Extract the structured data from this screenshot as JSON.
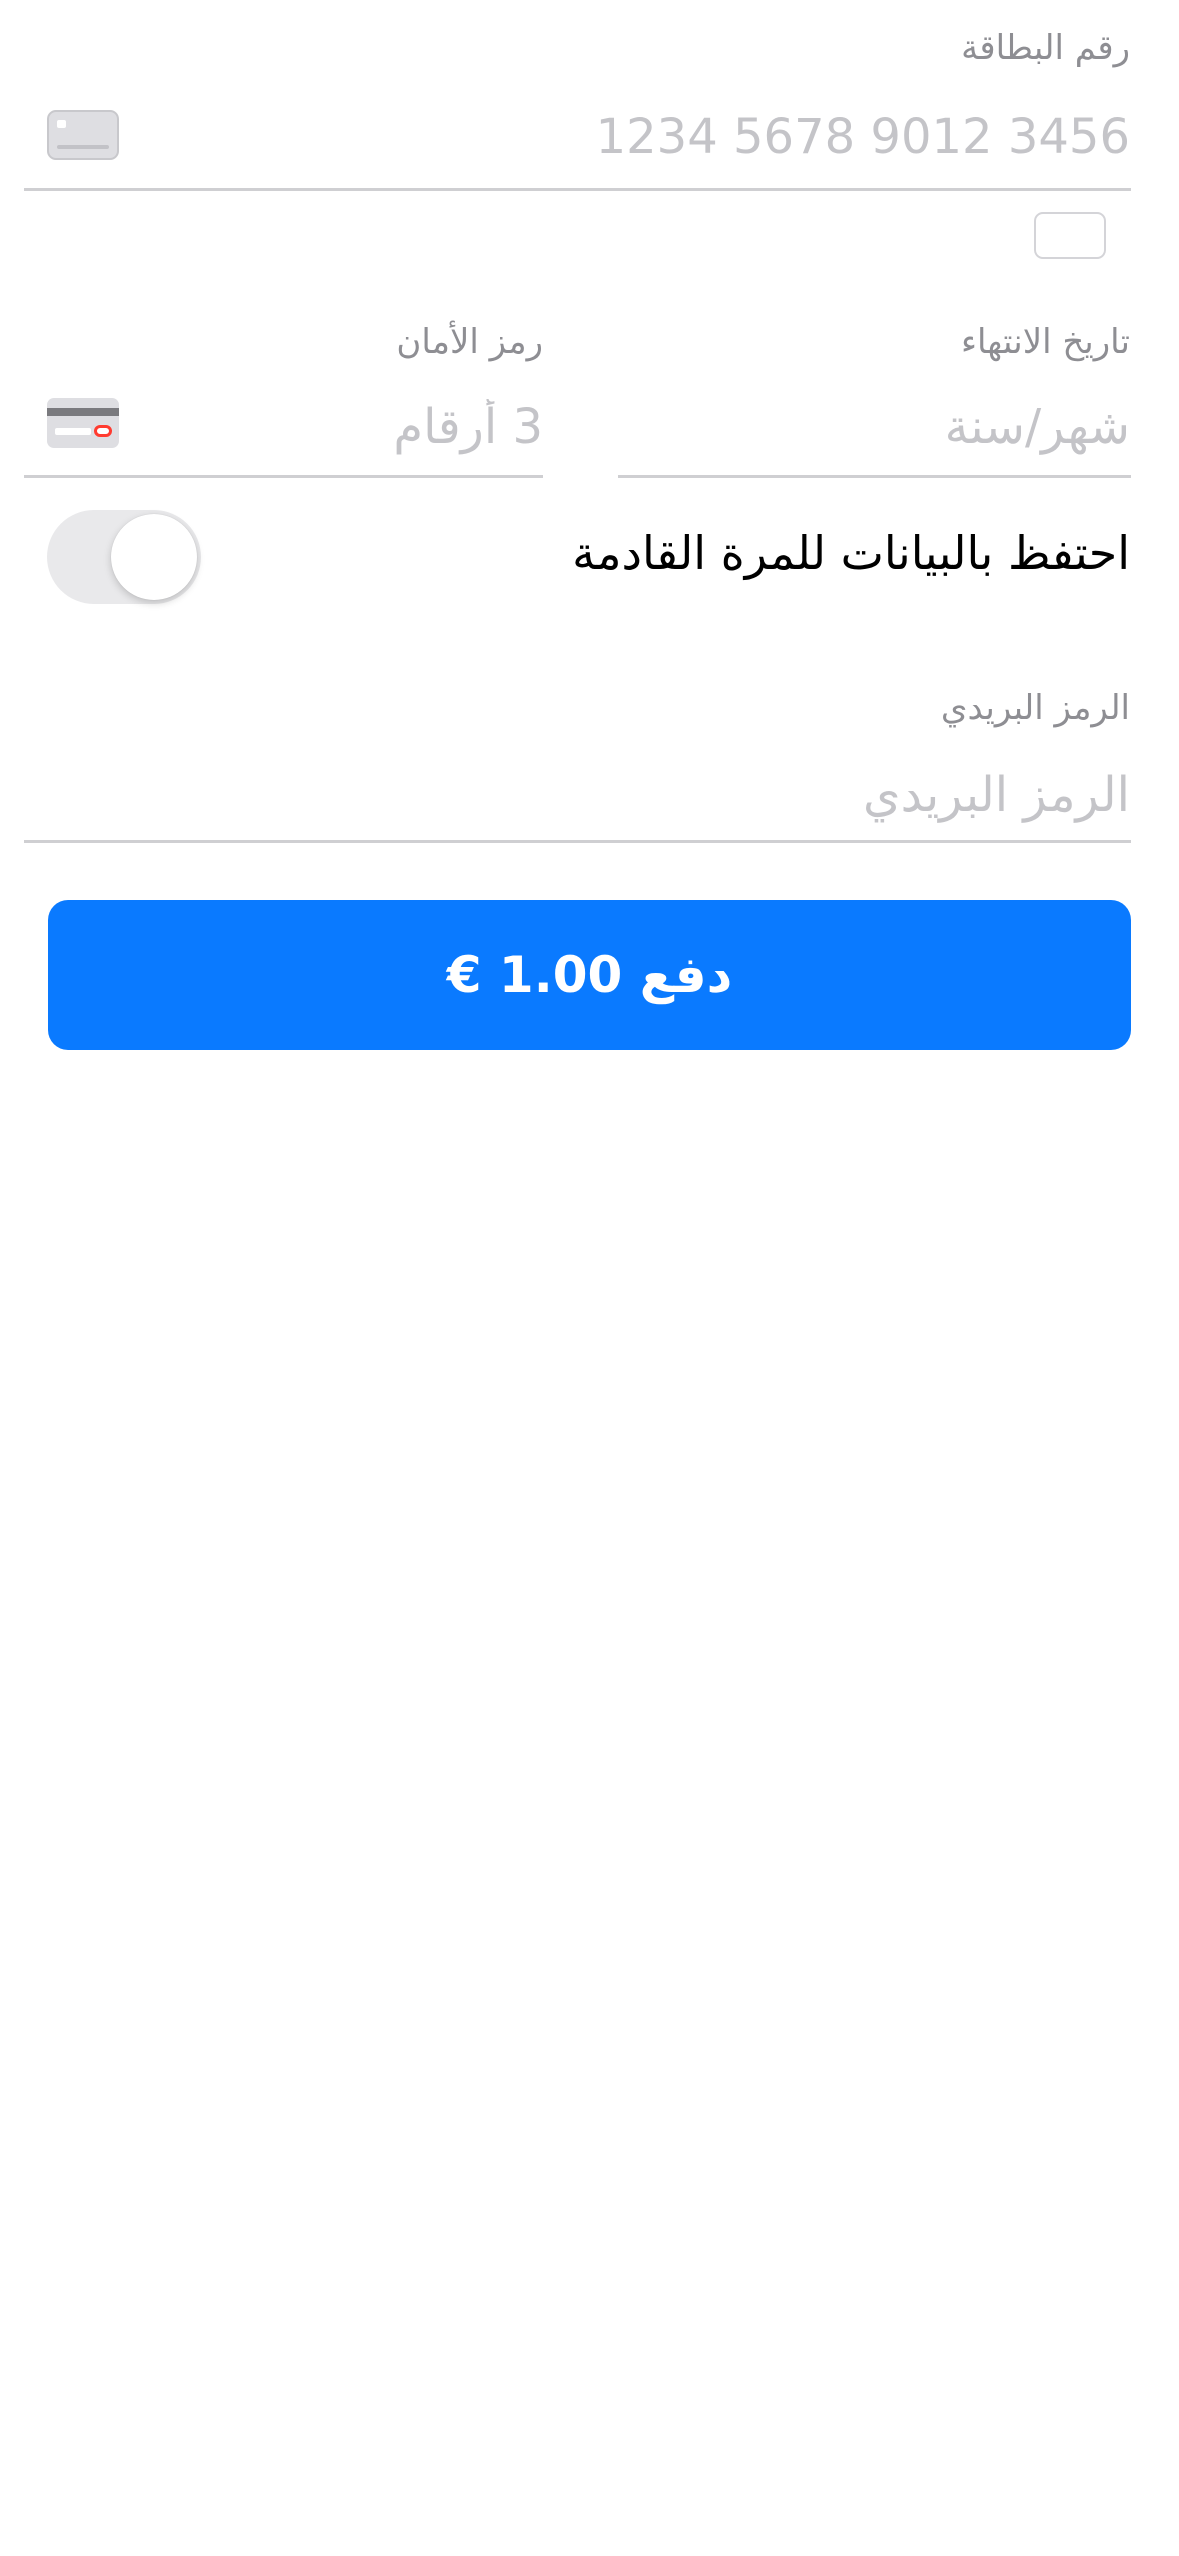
{
  "card_number": {
    "label": "رقم البطاقة",
    "placeholder": "1234 5678 9012 3456",
    "value": ""
  },
  "expiry": {
    "label": "تاريخ الانتهاء",
    "placeholder": "شهر/سنة",
    "value": ""
  },
  "cvc": {
    "label": "رمز الأمان",
    "placeholder": "3 أرقام",
    "value": ""
  },
  "save_toggle": {
    "label": "احتفظ بالبيانات للمرة القادمة",
    "on": false
  },
  "postal_code": {
    "label": "الرمز البريدي",
    "placeholder": "الرمز البريدي",
    "value": ""
  },
  "pay_button": {
    "label": "دفع 1.00 €"
  },
  "icons": {
    "card_number": "card-icon",
    "cvc": "cvc-card-back-icon"
  },
  "colors": {
    "accent": "#0a7aff",
    "label": "#8e8e93",
    "placeholder": "#c4c4c8",
    "divider": "#cfcfd2",
    "toggle_off": "#e9e9eb",
    "cvc_highlight": "#ff3b30"
  }
}
